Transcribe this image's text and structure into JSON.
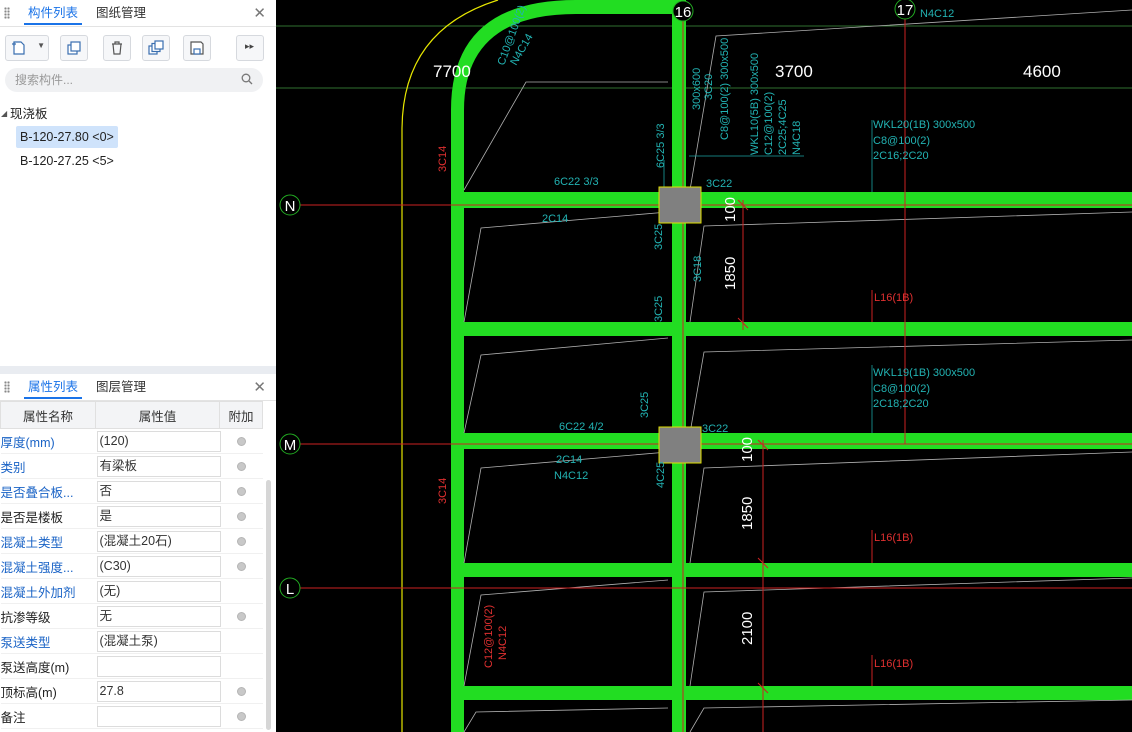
{
  "component_panel": {
    "tabs": [
      "构件列表",
      "图纸管理"
    ],
    "search_placeholder": "搜索构件...",
    "tree_group": "现浇板",
    "items": [
      "B-120-27.80 <0>",
      "B-120-27.25 <5>"
    ]
  },
  "property_panel": {
    "tabs": [
      "属性列表",
      "图层管理"
    ],
    "headers": [
      "属性名称",
      "属性值",
      "附加"
    ],
    "rows": [
      {
        "name": "厚度(mm)",
        "value": "(120)",
        "blue": true,
        "attach": true
      },
      {
        "name": "类别",
        "value": "有梁板",
        "blue": true,
        "attach": true
      },
      {
        "name": "是否叠合板...",
        "value": "否",
        "blue": true,
        "attach": true
      },
      {
        "name": "是否是楼板",
        "value": "是",
        "blue": false,
        "attach": true
      },
      {
        "name": "混凝土类型",
        "value": "(混凝土20石)",
        "blue": true,
        "attach": true
      },
      {
        "name": "混凝土强度...",
        "value": "(C30)",
        "blue": true,
        "attach": true
      },
      {
        "name": "混凝土外加剂",
        "value": "(无)",
        "blue": true,
        "attach": false
      },
      {
        "name": "抗渗等级",
        "value": "无",
        "blue": false,
        "attach": true
      },
      {
        "name": "泵送类型",
        "value": "(混凝土泵)",
        "blue": true,
        "attach": false
      },
      {
        "name": "泵送高度(m)",
        "value": "",
        "blue": false,
        "attach": false
      },
      {
        "name": "顶标高(m)",
        "value": "27.8",
        "blue": false,
        "attach": true
      },
      {
        "name": "备注",
        "value": "",
        "blue": false,
        "attach": true
      }
    ]
  },
  "cad": {
    "axis_numbers": [
      "16",
      "17"
    ],
    "axis_letters": [
      "N",
      "M",
      "L"
    ],
    "dimensions": [
      "7700",
      "3700",
      "4600",
      "1850",
      "1850",
      "2100",
      "100",
      "100"
    ],
    "annotations": {
      "arc_beam": "C10@100(2)",
      "arc_beam_2": "N4C14",
      "col_top_1": "300x600",
      "col_top_2": "3C20",
      "col_top_3": "C8@100(2) 300x500",
      "kl_a": "WKL10(5B) 300x500",
      "kl_b": "C12@100(2)",
      "kl_c": "2C25;4C25",
      "kl_d": "N4C18",
      "v_6c25": "6C25 3/3",
      "n_6c22": "6C22 3/3",
      "n_3c22": "3C22",
      "n_2c14": "2C14",
      "c_3c25a": "3C25",
      "c_3c18": "3C18",
      "c_3c25b": "3C25",
      "c_3c25c": "3C25",
      "m_6c22": "6C22 4/2",
      "m_3c22": "3C22",
      "m_2c14": "2C14",
      "m_n4c12": "N4C12",
      "m_4c25": "4C25",
      "wkl20_a": "WKL20(1B) 300x500",
      "wkl20_b": "C8@100(2)",
      "wkl20_c": "2C16;2C20",
      "wkl19_a": "WKL19(1B) 300x500",
      "wkl19_b": "C8@100(2)",
      "wkl19_c": "2C18;2C20",
      "l16_1": "L16(1B)",
      "l16_2": "L16(1B)",
      "l16_3": "L16(1B)",
      "red_3c14_a": "3C14",
      "red_3c14_b": "3C14",
      "red_c12": "C12@100(2)",
      "red_n4c12": "N4C12",
      "top_n4c12": "N4C12"
    }
  }
}
